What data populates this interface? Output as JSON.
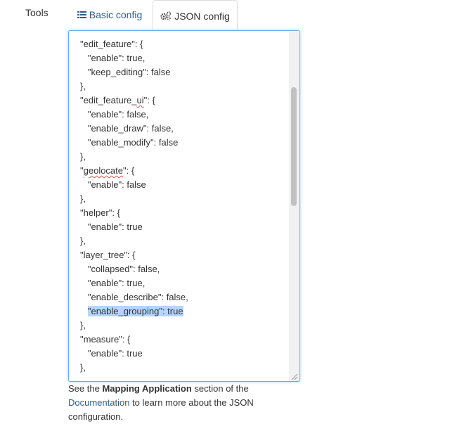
{
  "form": {
    "field_label": "Tools"
  },
  "tabs": {
    "basic_label": "Basic config",
    "json_label": "JSON config",
    "active": "json"
  },
  "editor": {
    "highlighted_line": 19,
    "spellcheck_lines": [
      4,
      9
    ],
    "scroll_thumb_fraction_start": 0.16,
    "scroll_thumb_fraction_length": 0.34,
    "lines": [
      "\"edit_feature\": {",
      "   \"enable\": true,",
      "   \"keep_editing\": false",
      "},",
      "\"edit_feature_ui\": {",
      "   \"enable\": false,",
      "   \"enable_draw\": false,",
      "   \"enable_modify\": false",
      "},",
      "\"geolocate\": {",
      "   \"enable\": false",
      "},",
      "\"helper\": {",
      "   \"enable\": true",
      "},",
      "\"layer_tree\": {",
      "   \"collapsed\": false,",
      "   \"enable\": true,",
      "   \"enable_describe\": false,",
      "   \"enable_grouping\": true",
      "},",
      "\"measure\": {",
      "   \"enable\": true",
      "},"
    ]
  },
  "help": {
    "prefix": "See the ",
    "bold": "Mapping Application",
    "middle": " section of the ",
    "link": "Documentation",
    "suffix": " to learn more about the JSON configuration."
  },
  "colors": {
    "accent_link": "#2c5c8f",
    "focus_border": "#66afe9",
    "selection": "#b4d5fe"
  }
}
